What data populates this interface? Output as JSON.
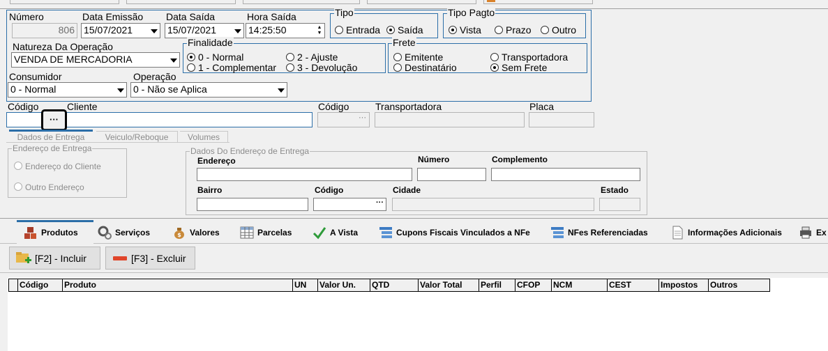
{
  "header": {
    "numero_label": "Número",
    "numero_value": "806",
    "data_emissao_label": "Data Emissão",
    "data_emissao_value": "15/07/2021",
    "data_saida_label": "Data Saída",
    "data_saida_value": "15/07/2021",
    "hora_saida_label": "Hora Saída",
    "hora_saida_value": "14:25:50",
    "tipo": {
      "title": "Tipo",
      "options": [
        "Entrada",
        "Saída"
      ],
      "selected": "Saída"
    },
    "tipo_pagto": {
      "title": "Tipo Pagto",
      "options": [
        "Vista",
        "Prazo",
        "Outro"
      ],
      "selected": "Vista"
    },
    "natureza_label": "Natureza Da Operação",
    "natureza_value": "VENDA DE MERCADORIA",
    "finalidade": {
      "title": "Finalidade",
      "options": [
        "0 - Normal",
        "2 - Ajuste",
        "1 - Complementar",
        "3 - Devolução"
      ],
      "selected": "0 - Normal"
    },
    "frete": {
      "title": "Frete",
      "options": [
        "Emitente",
        "Transportadora",
        "Destinatário",
        "Sem Frete"
      ],
      "selected": "Sem Frete"
    },
    "consumidor_label": "Consumidor",
    "consumidor_value": "0 - Normal",
    "operacao_label": "Operação",
    "operacao_value": "0 - Não se Aplica"
  },
  "cliente": {
    "codigo_label": "Código",
    "cliente_label": "Cliente",
    "ellipsis": "···"
  },
  "transportadora": {
    "codigo_label": "Código",
    "transportadora_label": "Transportadora",
    "placa_label": "Placa",
    "ellipsis": "···"
  },
  "entrega_tabs": [
    "Dados de Entrega",
    "Veiculo/Reboque",
    "Volumes"
  ],
  "entrega": {
    "endereco_group_title": "Endereço de Entrega",
    "opt_cliente": "Endereço do Cliente",
    "opt_outro": "Outro Endereço",
    "dados_group_title": "Dados Do Endereço de Entrega",
    "endereco_label": "Endereço",
    "numero_label": "Número",
    "complemento_label": "Complemento",
    "bairro_label": "Bairro",
    "codigo_label": "Código",
    "cidade_label": "Cidade",
    "estado_label": "Estado",
    "ellipsis": "···"
  },
  "main_tabs": [
    "Produtos",
    "Serviços",
    "Valores",
    "Parcelas",
    "A Vista",
    "Cupons Fiscais Vinculados a NFe",
    "NFes Referenciadas",
    "Informações Adicionais",
    "Ex"
  ],
  "toolbar": {
    "incluir_label": "[F2] - Incluir",
    "excluir_label": "[F3] - Excluir"
  },
  "grid_columns": [
    "Código",
    "Produto",
    "UN",
    "Valor Un.",
    "QTD",
    "Valor Total",
    "Perfil",
    "CFOP",
    "NCM",
    "CEST",
    "Impostos",
    "Outros"
  ],
  "colors": {
    "accent_border": "#2b6ea8",
    "highlight": "#000000"
  }
}
